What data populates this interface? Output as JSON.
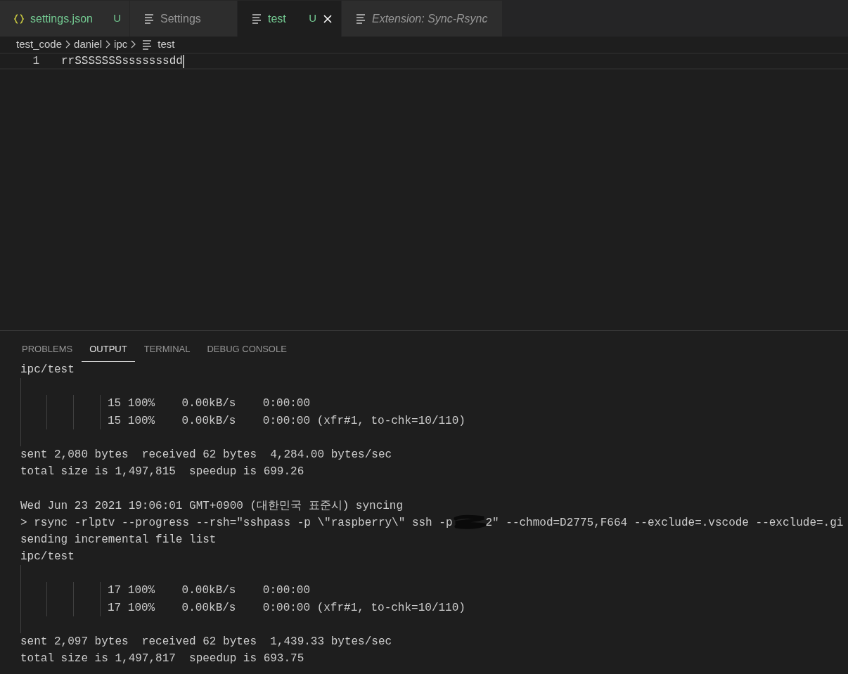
{
  "tabs": [
    {
      "label": "settings.json",
      "kind": "json",
      "modified": true,
      "badge": "U",
      "selected": false,
      "preview": false
    },
    {
      "label": "Settings",
      "kind": "file",
      "modified": false,
      "selected": false,
      "preview": false
    },
    {
      "label": "test",
      "kind": "file",
      "modified": true,
      "badge": "U",
      "selected": true,
      "preview": false
    },
    {
      "label": "Extension: Sync-Rsync",
      "kind": "file",
      "modified": false,
      "selected": false,
      "preview": true
    }
  ],
  "breadcrumb": [
    {
      "label": "test_code",
      "kind": "folder"
    },
    {
      "label": "daniel",
      "kind": "folder"
    },
    {
      "label": "ipc",
      "kind": "folder"
    },
    {
      "label": "test",
      "kind": "file"
    }
  ],
  "editor": {
    "lines": [
      {
        "number": "1",
        "text": "rrSSSSSSSsssssssdd"
      }
    ]
  },
  "panel": {
    "tabs": [
      {
        "label": "PROBLEMS",
        "selected": false
      },
      {
        "label": "OUTPUT",
        "selected": true
      },
      {
        "label": "TERMINAL",
        "selected": false
      },
      {
        "label": "DEBUG CONSOLE",
        "selected": false
      }
    ],
    "output": [
      {
        "kind": "text",
        "text": "ipc/test"
      },
      {
        "kind": "guide"
      },
      {
        "kind": "progress",
        "text": "15 100%    0.00kB/s    0:00:00"
      },
      {
        "kind": "progress",
        "text": "15 100%    0.00kB/s    0:00:00 (xfr#1, to-chk=10/110)"
      },
      {
        "kind": "guide"
      },
      {
        "kind": "text",
        "text": "sent 2,080 bytes  received 62 bytes  4,284.00 bytes/sec"
      },
      {
        "kind": "text",
        "text": "total size is 1,497,815  speedup is 699.26"
      },
      {
        "kind": "blank"
      },
      {
        "kind": "text",
        "text": "Wed Jun 23 2021 19:06:01 GMT+0900 (대한민국 표준시) syncing"
      },
      {
        "kind": "redacted",
        "before": "> rsync -rlptv --progress --rsh=\"sshpass -p \\\"raspberry\\\" ssh -p",
        "after": "2\" --chmod=D2775,F664 --exclude=.vscode --exclude=.gi"
      },
      {
        "kind": "text",
        "text": "sending incremental file list"
      },
      {
        "kind": "text",
        "text": "ipc/test"
      },
      {
        "kind": "guide"
      },
      {
        "kind": "progress",
        "text": "17 100%    0.00kB/s    0:00:00"
      },
      {
        "kind": "progress",
        "text": "17 100%    0.00kB/s    0:00:00 (xfr#1, to-chk=10/110)"
      },
      {
        "kind": "guide"
      },
      {
        "kind": "text",
        "text": "sent 2,097 bytes  received 62 bytes  1,439.33 bytes/sec"
      },
      {
        "kind": "text",
        "text": "total size is 1,497,817  speedup is 693.75"
      }
    ]
  }
}
